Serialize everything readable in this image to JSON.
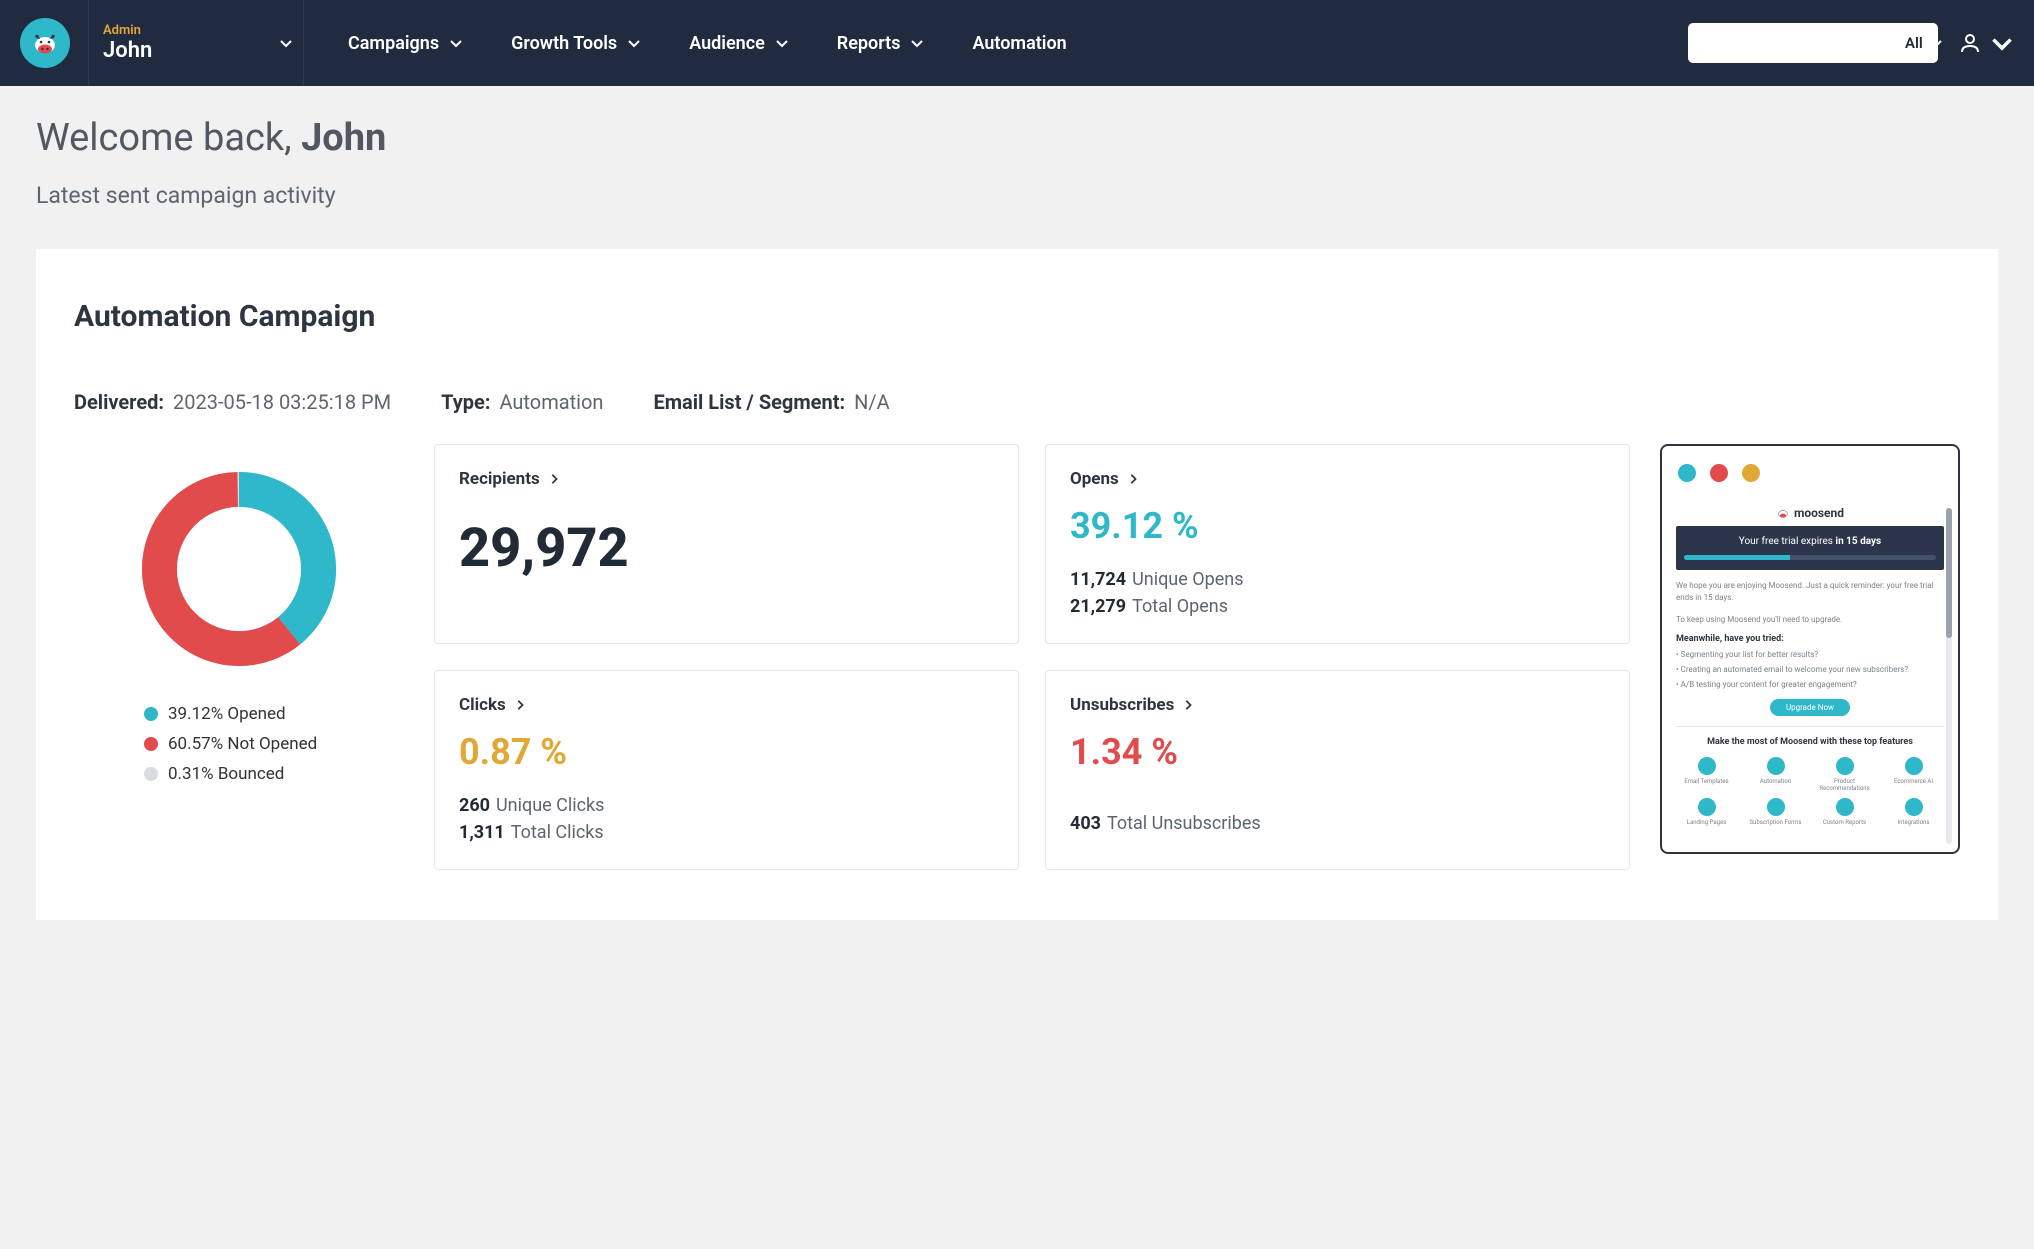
{
  "header": {
    "role": "Admin",
    "user_name": "John",
    "nav": {
      "campaigns": "Campaigns",
      "growth_tools": "Growth Tools",
      "audience": "Audience",
      "reports": "Reports",
      "automation": "Automation"
    },
    "search_filter": "All"
  },
  "page": {
    "welcome_prefix": "Welcome back, ",
    "welcome_name": "John",
    "subtitle": "Latest sent campaign activity"
  },
  "campaign": {
    "title": "Automation Campaign",
    "delivered_label": "Delivered:",
    "delivered_value": "2023-05-18 03:25:18 PM",
    "type_label": "Type:",
    "type_value": "Automation",
    "list_label": "Email List / Segment:",
    "list_value": "N/A"
  },
  "chart_data": {
    "type": "pie",
    "title": "",
    "series": [
      {
        "name": "Opened",
        "value": 39.12,
        "color": "#2eb8c9"
      },
      {
        "name": "Not Opened",
        "value": 60.57,
        "color": "#e24b4b"
      },
      {
        "name": "Bounced",
        "value": 0.31,
        "color": "#d8dce0"
      }
    ]
  },
  "legend": {
    "opened": "39.12% Opened",
    "not_opened": "60.57% Not Opened",
    "bounced": "0.31% Bounced"
  },
  "cards": {
    "recipients": {
      "label": "Recipients",
      "value": "29,972"
    },
    "opens": {
      "label": "Opens",
      "pct": "39.12 %",
      "unique_n": "11,724",
      "unique_l": "Unique Opens",
      "total_n": "21,279",
      "total_l": "Total Opens"
    },
    "clicks": {
      "label": "Clicks",
      "pct": "0.87 %",
      "unique_n": "260",
      "unique_l": "Unique Clicks",
      "total_n": "1,311",
      "total_l": "Total Clicks"
    },
    "unsub": {
      "label": "Unsubscribes",
      "pct": "1.34 %",
      "total_n": "403",
      "total_l": "Total Unsubscribes"
    }
  },
  "preview": {
    "brand": "moosend",
    "banner_prefix": "Your free trial expires ",
    "banner_bold": "in 15 days",
    "p1": "We hope you are enjoying Moosend. Just a quick reminder: your free trial ends in 15 days.",
    "p2": "To keep using Moosend you'll need to upgrade.",
    "sub": "Meanwhile, have you tried:",
    "li1": "• Segmenting your list for better results?",
    "li2": "• Creating an automated email to welcome your new subscribers?",
    "li3": "• A/B testing your content for greater engagement?",
    "cta": "Upgrade Now",
    "footer_t": "Make the most of Moosend with these top features",
    "f1": "Email Templates",
    "f2": "Automation",
    "f3": "Product Recommendations",
    "f4": "Ecommerce AI",
    "f5": "Landing Pages",
    "f6": "Subscription Forms",
    "f7": "Custom Reports",
    "f8": "Integrations"
  },
  "colors": {
    "teal": "#2eb8c9",
    "red": "#e24b4b",
    "amber": "#e0a836",
    "grey": "#d8dce0"
  }
}
